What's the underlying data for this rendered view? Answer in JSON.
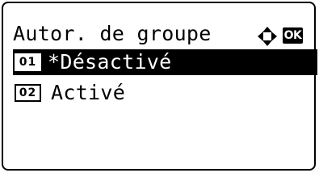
{
  "header": {
    "title": "Autor. de groupe",
    "nav_icon": "four-way-arrow-icon",
    "ok_label": "OK"
  },
  "menu": {
    "items": [
      {
        "number": "01",
        "label": "*Désactivé",
        "selected": true
      },
      {
        "number": "02",
        "label": "Activé",
        "selected": false
      }
    ]
  },
  "colors": {
    "background": "#ffffff",
    "foreground": "#000000",
    "highlight": "#000000"
  }
}
